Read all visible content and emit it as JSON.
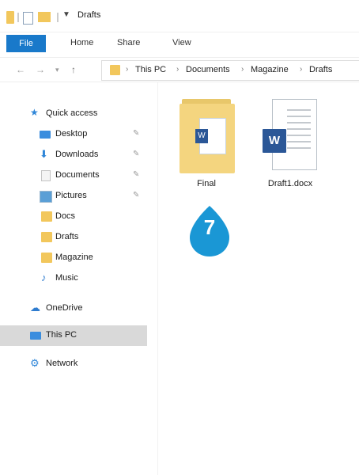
{
  "window": {
    "title": "Drafts"
  },
  "ribbon": {
    "tabs": [
      "File",
      "Home",
      "Share",
      "View"
    ]
  },
  "address": {
    "path": [
      "This PC",
      "Documents",
      "Magazine",
      "Drafts"
    ]
  },
  "sidebar": {
    "items": [
      {
        "label": "Quick access",
        "icon": "star-icon"
      },
      {
        "label": "Desktop",
        "icon": "desktop-icon",
        "pinned": true
      },
      {
        "label": "Downloads",
        "icon": "download-icon",
        "pinned": true
      },
      {
        "label": "Documents",
        "icon": "documents-icon",
        "pinned": true
      },
      {
        "label": "Pictures",
        "icon": "pictures-icon",
        "pinned": true
      },
      {
        "label": "Docs",
        "icon": "folder-icon"
      },
      {
        "label": "Drafts",
        "icon": "folder-icon"
      },
      {
        "label": "Magazine",
        "icon": "folder-icon"
      },
      {
        "label": "Music",
        "icon": "music-icon"
      },
      {
        "label": "OneDrive",
        "icon": "cloud-icon"
      },
      {
        "label": "This PC",
        "icon": "pc-icon",
        "selected": true
      },
      {
        "label": "Network",
        "icon": "network-icon"
      }
    ]
  },
  "files": [
    {
      "name": "Final",
      "type": "folder"
    },
    {
      "name": "Draft1.docx",
      "type": "word-document"
    }
  ],
  "word_glyph": "W",
  "callout": {
    "number": "7",
    "color": "#1a97d5"
  },
  "colors": {
    "accent": "#1979ca",
    "folder": "#f2c75c",
    "word": "#2b5797",
    "selected": "#d9d9d9"
  }
}
